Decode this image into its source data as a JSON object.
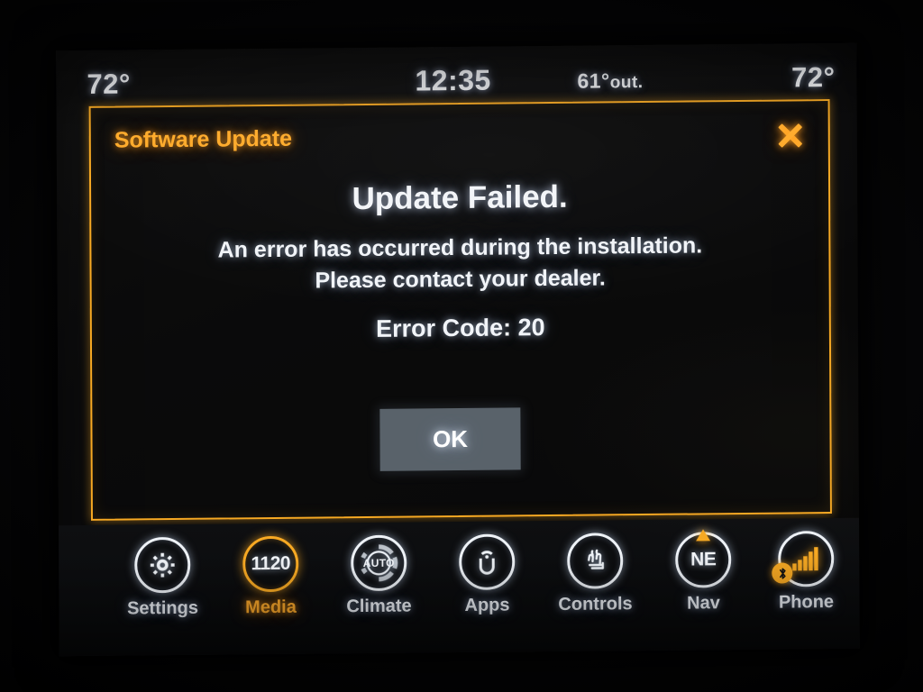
{
  "status_bar": {
    "temp_left": "72°",
    "clock": "12:35",
    "temp_outside_value": "61°",
    "temp_outside_label": "out.",
    "temp_right": "72°"
  },
  "dialog": {
    "title": "Software Update",
    "close_icon": "close-x-icon",
    "heading": "Update Failed.",
    "body_line_1": "An error has occurred during the installation.",
    "body_line_2": "Please contact your dealer.",
    "error_code": "Error Code: 20",
    "ok_label": "OK",
    "border_color": "#f7a923",
    "ok_button_color": "#59626a"
  },
  "navbar": {
    "items": [
      {
        "label": "Settings",
        "icon": "gear-icon",
        "active": false
      },
      {
        "label": "Media",
        "icon": "radio-preset-icon",
        "value": "1120",
        "active": true
      },
      {
        "label": "Climate",
        "icon": "climate-dial-icon",
        "value": "AUTO",
        "active": false
      },
      {
        "label": "Apps",
        "icon": "uconnect-u-icon",
        "active": false
      },
      {
        "label": "Controls",
        "icon": "heated-seat-icon",
        "active": false
      },
      {
        "label": "Nav",
        "icon": "compass-icon",
        "value": "NE",
        "active": false
      },
      {
        "label": "Phone",
        "icon": "signal-bars-icon",
        "badge": "bluetooth-icon",
        "active": false
      }
    ]
  },
  "theme": {
    "accent": "#f7a923",
    "text": "#f1f4f8",
    "screen_bg": "#0d0d0e"
  }
}
